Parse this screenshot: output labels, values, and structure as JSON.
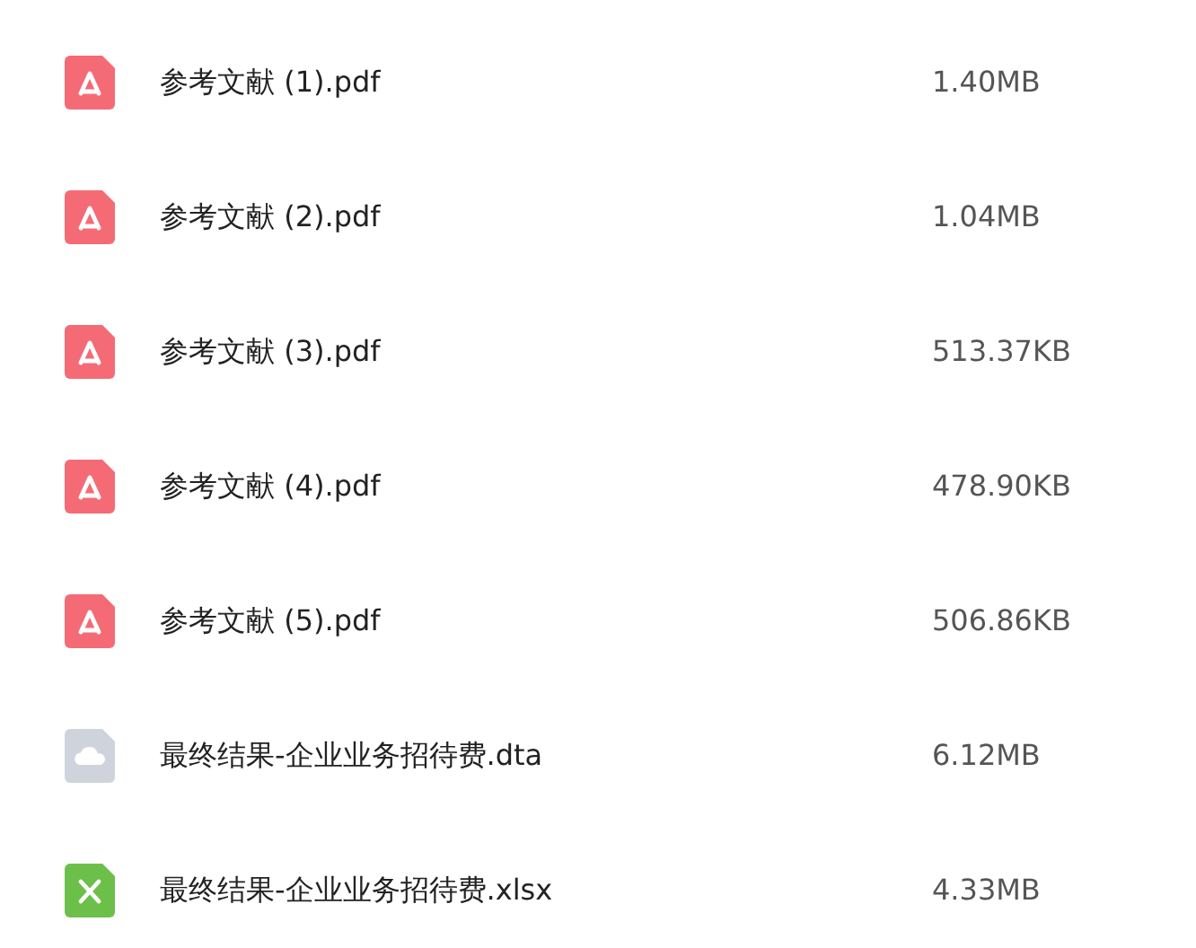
{
  "files": [
    {
      "kind": "pdf",
      "name": "参考文献 (1).pdf",
      "size": "1.40MB"
    },
    {
      "kind": "pdf",
      "name": "参考文献 (2).pdf",
      "size": "1.04MB"
    },
    {
      "kind": "pdf",
      "name": "参考文献 (3).pdf",
      "size": "513.37KB"
    },
    {
      "kind": "pdf",
      "name": "参考文献 (4).pdf",
      "size": "478.90KB"
    },
    {
      "kind": "pdf",
      "name": "参考文献 (5).pdf",
      "size": "506.86KB"
    },
    {
      "kind": "generic",
      "name": "最终结果-企业业务招待费.dta",
      "size": "6.12MB"
    },
    {
      "kind": "excel",
      "name": "最终结果-企业业务招待费.xlsx",
      "size": "4.33MB"
    }
  ]
}
